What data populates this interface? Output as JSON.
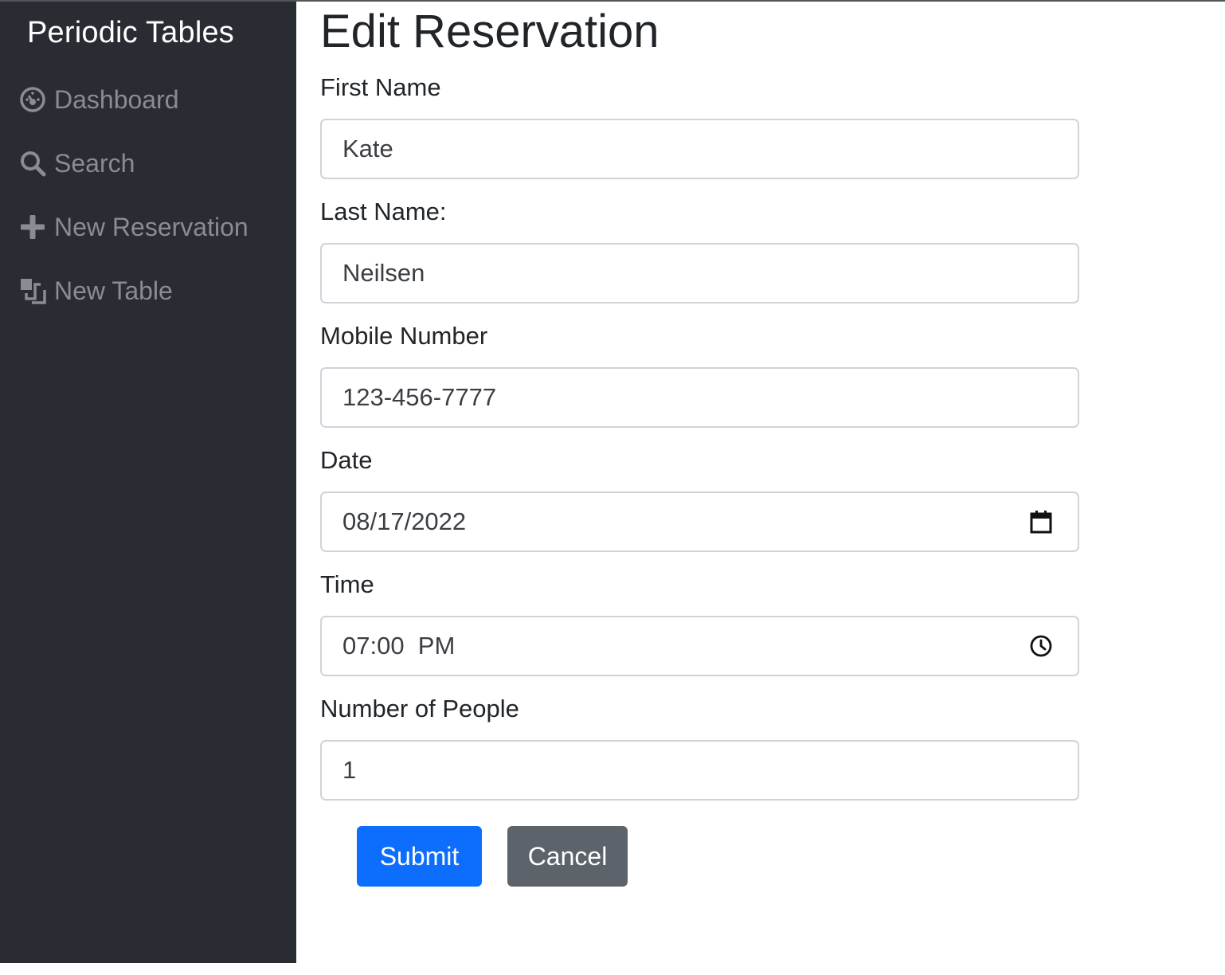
{
  "sidebar": {
    "brand": "Periodic Tables",
    "items": [
      {
        "label": "Dashboard",
        "icon": "dashboard-icon"
      },
      {
        "label": "Search",
        "icon": "search-icon"
      },
      {
        "label": "New Reservation",
        "icon": "plus-icon"
      },
      {
        "label": "New Table",
        "icon": "layers-icon"
      }
    ]
  },
  "main": {
    "title": "Edit Reservation",
    "fields": {
      "first_name": {
        "label": "First Name",
        "value": "Kate"
      },
      "last_name": {
        "label": "Last Name:",
        "value": "Neilsen"
      },
      "mobile": {
        "label": "Mobile Number",
        "value": "123-456-7777"
      },
      "date": {
        "label": "Date",
        "value": "08/17/2022",
        "icon": "calendar-icon"
      },
      "time": {
        "label": "Time",
        "value": "07:00  PM",
        "icon": "clock-icon"
      },
      "people": {
        "label": "Number of People",
        "value": "1"
      }
    },
    "buttons": {
      "submit": "Submit",
      "cancel": "Cancel"
    }
  },
  "colors": {
    "sidebar_bg": "#2a2c34",
    "primary": "#0d6efd",
    "secondary": "#5c636a",
    "nav_text": "#8a8c92"
  }
}
